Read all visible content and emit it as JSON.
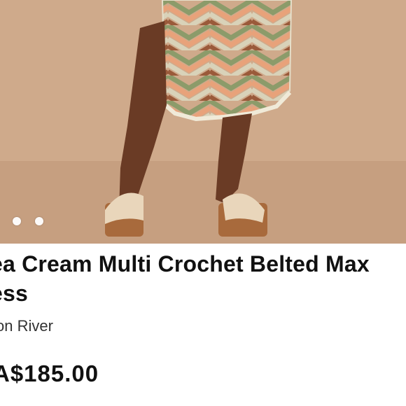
{
  "product": {
    "title": "ea Cream Multi Crochet Belted Max ess",
    "brand": "on River",
    "price": "A$185.00"
  },
  "gallery": {
    "image_icon": "product-photo-icon",
    "dots": [
      "slide-1",
      "slide-2"
    ]
  },
  "colors": {
    "backdrop": "#cda88a",
    "text": "#111111"
  }
}
